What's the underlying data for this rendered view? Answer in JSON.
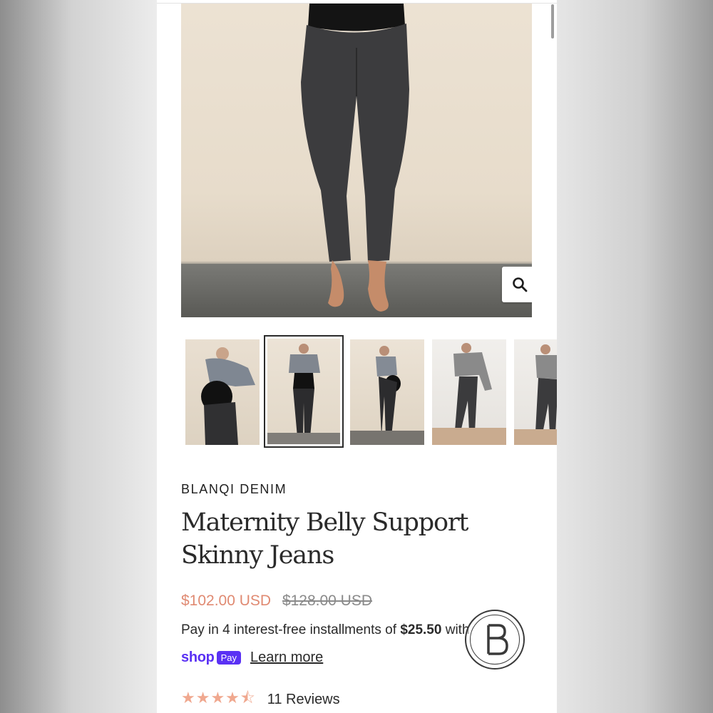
{
  "product": {
    "brand": "BLANQI DENIM",
    "title": "Maternity Belly Support Skinny Jeans",
    "price_sale": "$102.00 USD",
    "price_regular": "$128.00 USD",
    "installments_prefix": "Pay in 4 interest-free installments of ",
    "installments_amount": "$25.50",
    "installments_suffix": " with",
    "shop_logo": "shop",
    "shop_pay_badge": "Pay",
    "learn_more": "Learn more",
    "rating": 4.5,
    "rating_stars": "★★★★⯪",
    "reviews_count": "11 Reviews"
  },
  "gallery": {
    "zoom_icon": "search-icon",
    "thumbnail_count": 5,
    "selected_thumbnail": 2
  },
  "colors": {
    "sale_price": "#e08a72",
    "shop_purple": "#5a31f4",
    "stars": "#f0a88f"
  }
}
